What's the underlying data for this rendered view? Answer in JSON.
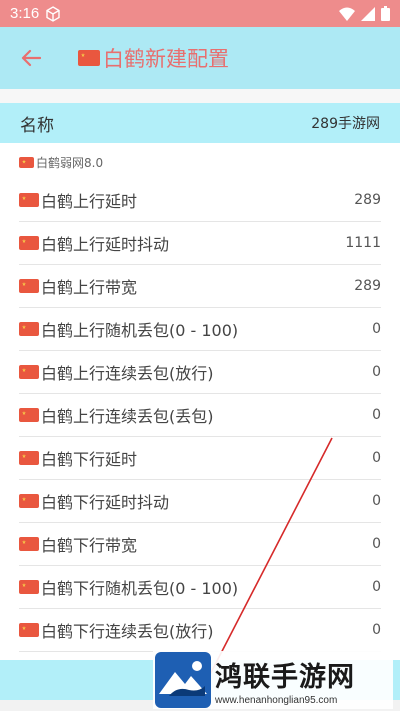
{
  "status_bar": {
    "time": "3:16",
    "icons": [
      "box-icon",
      "wifi-icon",
      "signal-icon",
      "battery-icon"
    ]
  },
  "app_bar": {
    "title": "白鹤新建配置",
    "back_icon": "back-arrow-icon"
  },
  "name_field": {
    "label": "名称",
    "value": "289手游网"
  },
  "group_header": "白鹤弱网8.0",
  "settings": [
    {
      "label": "白鹤上行延时",
      "value": "289"
    },
    {
      "label": "白鹤上行延时抖动",
      "value": "1111"
    },
    {
      "label": "白鹤上行带宽",
      "value": "289"
    },
    {
      "label": "白鹤上行随机丢包(0 - 100)",
      "value": "0"
    },
    {
      "label": "白鹤上行连续丢包(放行)",
      "value": "0"
    },
    {
      "label": "白鹤上行连续丢包(丢包)",
      "value": "0"
    },
    {
      "label": "白鹤下行延时",
      "value": "0"
    },
    {
      "label": "白鹤下行延时抖动",
      "value": "0"
    },
    {
      "label": "白鹤下行带宽",
      "value": "0"
    },
    {
      "label": "白鹤下行随机丢包(0 - 100)",
      "value": "0"
    },
    {
      "label": "白鹤下行连续丢包(放行)",
      "value": "0"
    }
  ],
  "watermark": {
    "title": "鸿联手游网",
    "url": "www.henanhonglian95.com"
  },
  "colors": {
    "status_bar": "#ee8c8c",
    "app_bar": "#ade9f4",
    "title_text": "#e86f6f",
    "name_row": "#b2eff9",
    "annotation_line": "#d62a2a"
  }
}
